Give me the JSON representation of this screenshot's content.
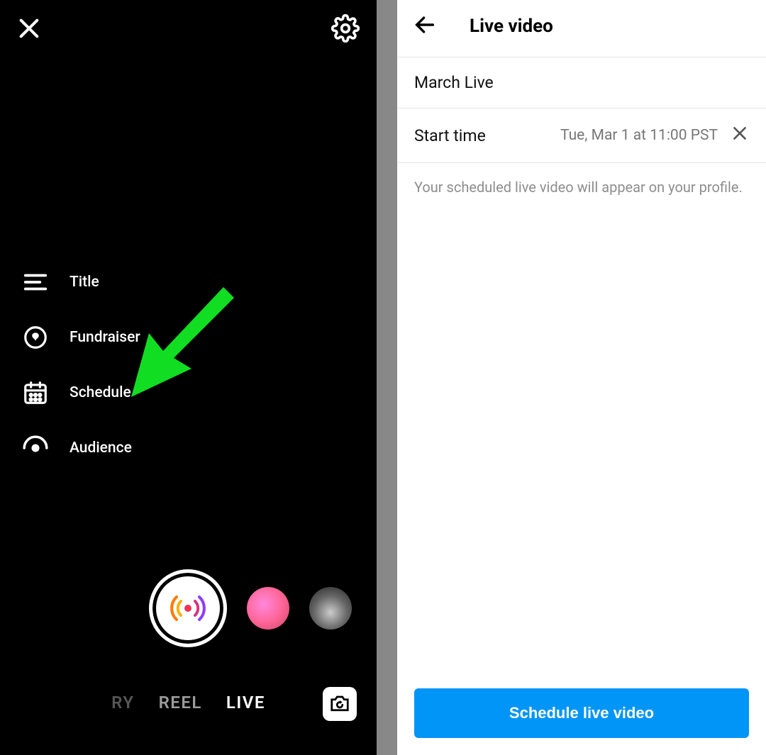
{
  "left": {
    "options": {
      "title": "Title",
      "fundraiser": "Fundraiser",
      "schedule": "Schedule",
      "audience": "Audience"
    },
    "modes": {
      "story": "RY",
      "reel": "REEL",
      "live": "LIVE"
    }
  },
  "right": {
    "header_title": "Live video",
    "event_title": "March Live",
    "start_time_label": "Start time",
    "start_time_value": "Tue, Mar 1 at 11:00 PST",
    "help_text": "Your scheduled live video will appear on your profile.",
    "schedule_button": "Schedule live video"
  }
}
